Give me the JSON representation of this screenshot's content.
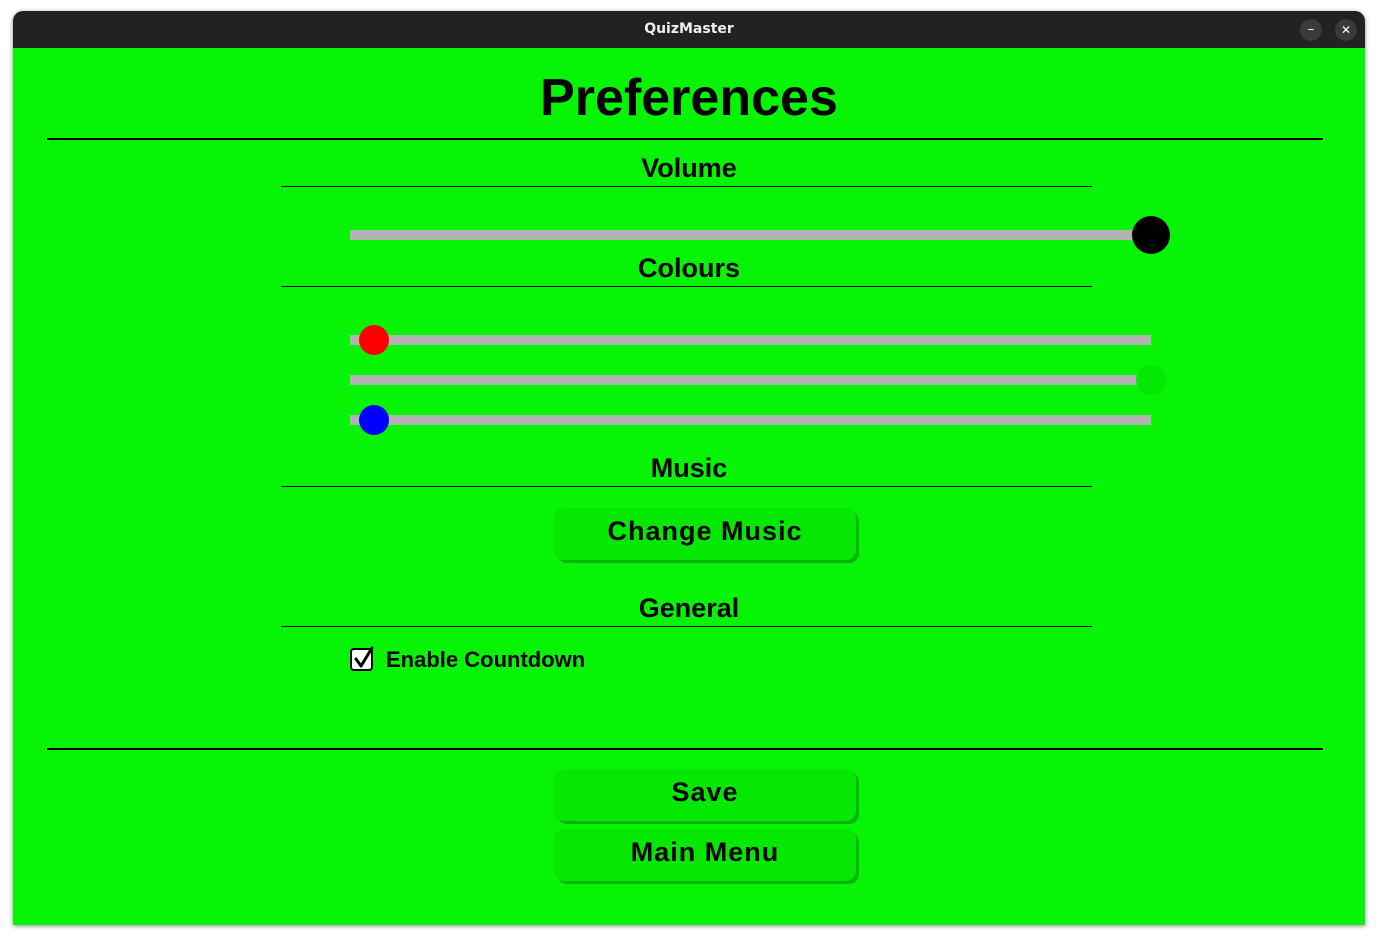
{
  "window": {
    "title": "QuizMaster",
    "minimize_icon": "minimize-icon",
    "close_icon": "close-icon"
  },
  "page": {
    "title": "Preferences",
    "background_color": "#07f407"
  },
  "volume": {
    "heading": "Volume",
    "level": 1.0,
    "knob_color": "#000000"
  },
  "colours": {
    "heading": "Colours",
    "sliders": [
      {
        "channel": "red",
        "level": 0.03,
        "knob_color": "#ff0000"
      },
      {
        "channel": "green",
        "level": 1.0,
        "knob_color": "#05e805"
      },
      {
        "channel": "blue",
        "level": 0.03,
        "knob_color": "#0000ff"
      }
    ]
  },
  "music": {
    "heading": "Music",
    "change_button": "Change Music"
  },
  "general": {
    "heading": "General",
    "countdown_label": "Enable Countdown",
    "countdown_checked": true
  },
  "actions": {
    "save_label": "Save",
    "main_menu_label": "Main Menu"
  }
}
